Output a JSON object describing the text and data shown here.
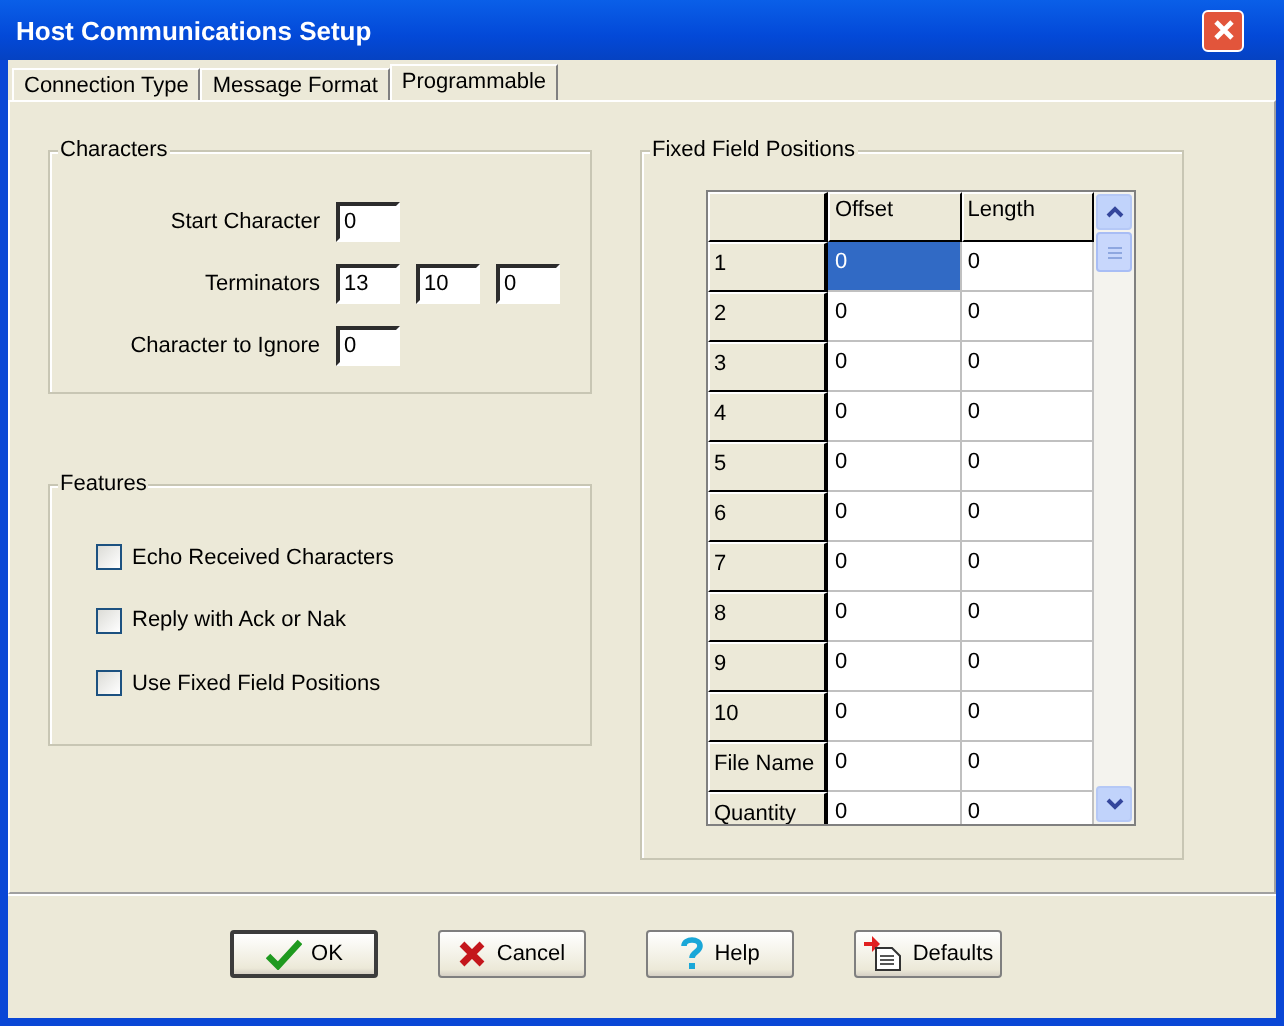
{
  "window": {
    "title": "Host Communications Setup"
  },
  "tabs": [
    {
      "label": "Connection Type",
      "selected": false
    },
    {
      "label": "Message Format",
      "selected": false
    },
    {
      "label": "Programmable",
      "selected": true
    }
  ],
  "characters": {
    "title": "Characters",
    "rows": [
      {
        "label": "Start Character",
        "values": [
          "0"
        ]
      },
      {
        "label": "Terminators",
        "values": [
          "13",
          "10",
          "0"
        ]
      },
      {
        "label": "Character to Ignore",
        "values": [
          "0"
        ]
      }
    ]
  },
  "features": {
    "title": "Features",
    "options": [
      {
        "label": "Echo Received Characters",
        "checked": false
      },
      {
        "label": "Reply with Ack or Nak",
        "checked": false
      },
      {
        "label": "Use Fixed Field Positions",
        "checked": false
      }
    ]
  },
  "fixed_fields": {
    "title": "Fixed Field Positions",
    "columns": [
      "Offset",
      "Length"
    ],
    "rows": [
      {
        "label": "1",
        "cells": [
          {
            "text": "0",
            "selected": true
          },
          {
            "text": "0",
            "selected": false
          }
        ]
      },
      {
        "label": "2",
        "cells": [
          {
            "text": "0",
            "selected": false
          },
          {
            "text": "0",
            "selected": false
          }
        ]
      },
      {
        "label": "3",
        "cells": [
          {
            "text": "0",
            "selected": false
          },
          {
            "text": "0",
            "selected": false
          }
        ]
      },
      {
        "label": "4",
        "cells": [
          {
            "text": "0",
            "selected": false
          },
          {
            "text": "0",
            "selected": false
          }
        ]
      },
      {
        "label": "5",
        "cells": [
          {
            "text": "0",
            "selected": false
          },
          {
            "text": "0",
            "selected": false
          }
        ]
      },
      {
        "label": "6",
        "cells": [
          {
            "text": "0",
            "selected": false
          },
          {
            "text": "0",
            "selected": false
          }
        ]
      },
      {
        "label": "7",
        "cells": [
          {
            "text": "0",
            "selected": false
          },
          {
            "text": "0",
            "selected": false
          }
        ]
      },
      {
        "label": "8",
        "cells": [
          {
            "text": "0",
            "selected": false
          },
          {
            "text": "0",
            "selected": false
          }
        ]
      },
      {
        "label": "9",
        "cells": [
          {
            "text": "0",
            "selected": false
          },
          {
            "text": "0",
            "selected": false
          }
        ]
      },
      {
        "label": "10",
        "cells": [
          {
            "text": "0",
            "selected": false
          },
          {
            "text": "0",
            "selected": false
          }
        ]
      },
      {
        "label": "File Name",
        "cells": [
          {
            "text": "0",
            "selected": false
          },
          {
            "text": "0",
            "selected": false
          }
        ]
      },
      {
        "label": "Quantity",
        "cells": [
          {
            "text": "0",
            "selected": false
          },
          {
            "text": "0",
            "selected": false
          }
        ]
      }
    ]
  },
  "buttons": [
    {
      "label": "OK",
      "kind": "ok"
    },
    {
      "label": "Cancel",
      "kind": "cancel"
    },
    {
      "label": "Help",
      "kind": "help"
    },
    {
      "label": "Defaults",
      "kind": "defaults"
    }
  ]
}
